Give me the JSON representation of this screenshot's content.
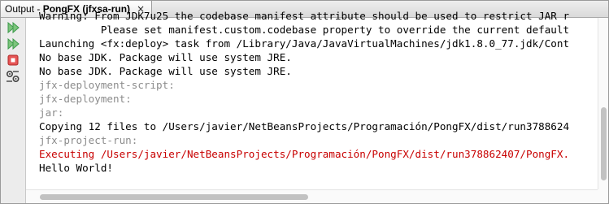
{
  "window": {
    "tab_prefix": "Output - ",
    "tab_title": "PongFX (jfxsa-run)",
    "close_glyph": "×"
  },
  "toolbar": {
    "buttons": [
      {
        "icon": "rerun-icon",
        "color": "#3c9a4a"
      },
      {
        "icon": "rerun-with-options-icon",
        "color": "#3c9a4a"
      },
      {
        "icon": "stop-icon",
        "color": "#d83b3b"
      },
      {
        "icon": "settings-icon",
        "color": "#444444"
      }
    ]
  },
  "console": {
    "lines": [
      {
        "style": "normal",
        "text": "Warning: From JDK7u25 the codebase manifest attribute should be used to restrict JAR r"
      },
      {
        "style": "normal",
        "text": "          Please set manifest.custom.codebase property to override the current default"
      },
      {
        "style": "normal",
        "text": "Launching <fx:deploy> task from /Library/Java/JavaVirtualMachines/jdk1.8.0_77.jdk/Cont"
      },
      {
        "style": "normal",
        "text": "No base JDK. Package will use system JRE."
      },
      {
        "style": "normal",
        "text": "No base JDK. Package will use system JRE."
      },
      {
        "style": "gray",
        "text": "jfx-deployment-script:"
      },
      {
        "style": "gray",
        "text": "jfx-deployment:"
      },
      {
        "style": "gray",
        "text": "jar:"
      },
      {
        "style": "normal",
        "text": "Copying 12 files to /Users/javier/NetBeansProjects/Programación/PongFX/dist/run3788624"
      },
      {
        "style": "gray",
        "text": "jfx-project-run:"
      },
      {
        "style": "red",
        "text": "Executing /Users/javier/NetBeansProjects/Programación/PongFX/dist/run378862407/PongFX."
      },
      {
        "style": "normal",
        "text": "Hello World!"
      }
    ]
  },
  "colors": {
    "normal": "#000000",
    "gray": "#8c8c8c",
    "red": "#c80000"
  }
}
